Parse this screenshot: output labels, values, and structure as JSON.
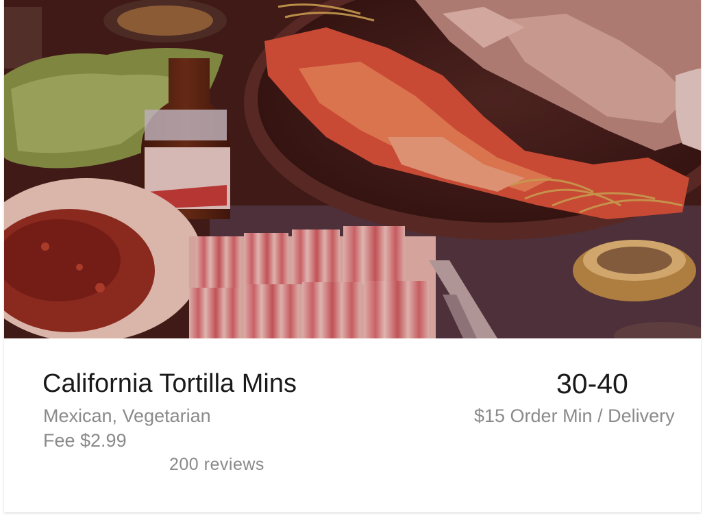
{
  "restaurant": {
    "name": "California Tortilla Mins",
    "cuisine": "Mexican, Vegetarian",
    "delivery_fee": "Fee $2.99",
    "reviews": "200 reviews",
    "delivery_time": "30-40",
    "order_min": "$15 Order Min / Delivery"
  },
  "image": {
    "icon": "food-photo-korean-bbq",
    "tint": "#8b2a1f"
  }
}
